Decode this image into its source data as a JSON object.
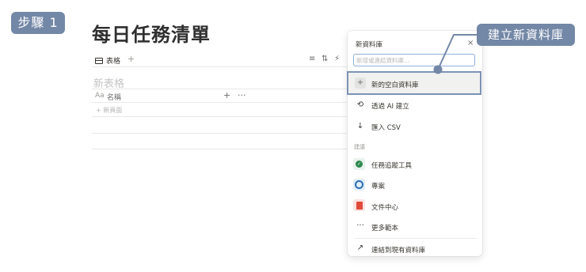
{
  "step_badge": "步驟 1",
  "page_title": "每日任務清單",
  "toolbar": {
    "view_tab_label": "表格",
    "add_view": "+",
    "filter_icon": "≡",
    "sort_icon": "⇅",
    "automation_icon": "⚡"
  },
  "table": {
    "title_placeholder": "新表格",
    "name_prefix": "Aa",
    "name_column": "名稱",
    "add_column": "+",
    "more": "···",
    "new_page": "+  新頁面"
  },
  "panel": {
    "title": "新資料庫",
    "close": "×",
    "search_placeholder": "新增或連結資料庫...",
    "actions": [
      {
        "icon": "+",
        "label": "新的空白資料庫"
      },
      {
        "icon": "⟲",
        "label": "透過 AI 建立"
      },
      {
        "icon": "↓",
        "label": "匯入 CSV"
      }
    ],
    "section_label": "建議",
    "suggestions": [
      {
        "icon": "check-circle",
        "label": "任務追蹤工具",
        "color": "#2f8a4f"
      },
      {
        "icon": "target",
        "label": "專案",
        "color": "#2c6fb3"
      },
      {
        "icon": "document",
        "label": "文件中心",
        "color": "#e2493b"
      }
    ],
    "more_icon": "···",
    "more_label": "更多範本",
    "link_icon": "↗",
    "link_label": "連結到現有資料庫"
  },
  "callout": "建立新資料庫"
}
